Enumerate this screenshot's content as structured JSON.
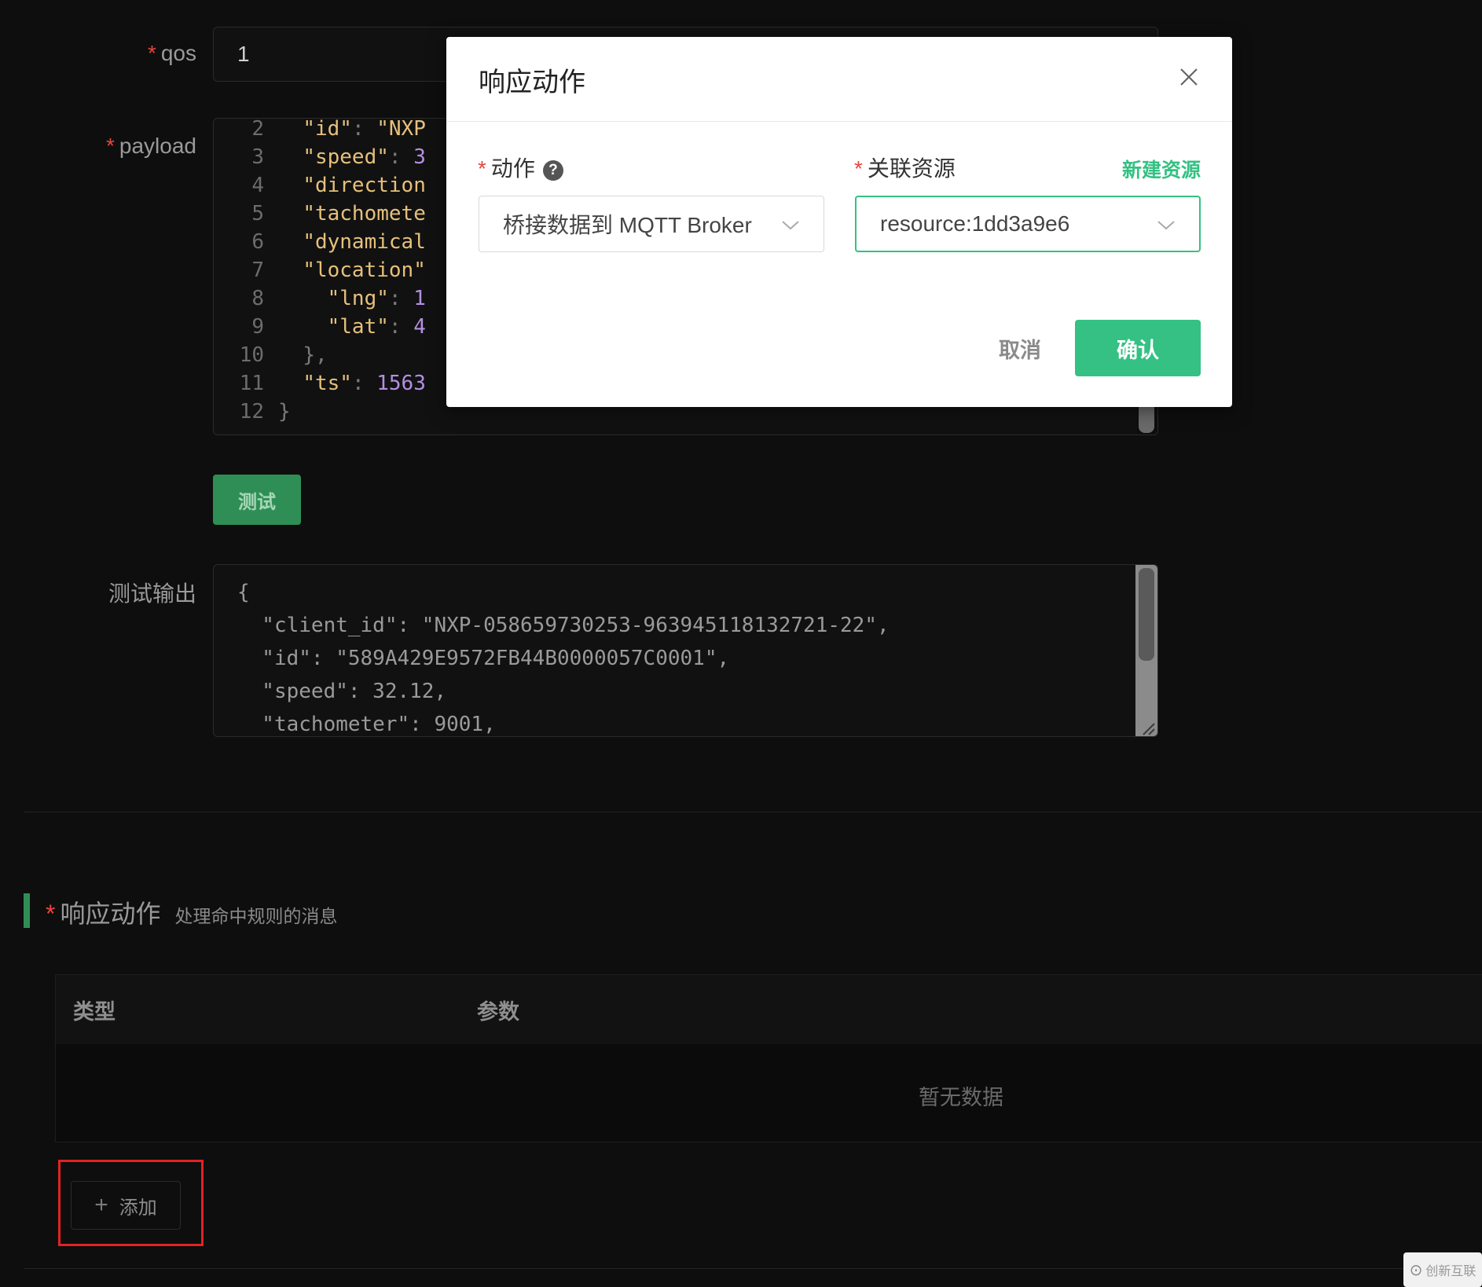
{
  "form": {
    "qos_label": "qos",
    "qos_value": "1",
    "payload_label": "payload",
    "test_button": "测试",
    "test_output_label": "测试输出"
  },
  "payload_editor": {
    "lines": [
      {
        "no": "2",
        "indent": "  ",
        "key": "\"id\"",
        "sep": ": ",
        "value": "\"NXP"
      },
      {
        "no": "3",
        "indent": "  ",
        "key": "\"speed\"",
        "sep": ": ",
        "value": "3"
      },
      {
        "no": "4",
        "indent": "  ",
        "key": "\"direction",
        "sep": "",
        "value": ""
      },
      {
        "no": "5",
        "indent": "  ",
        "key": "\"tachomete",
        "sep": "",
        "value": ""
      },
      {
        "no": "6",
        "indent": "  ",
        "key": "\"dynamical",
        "sep": "",
        "value": ""
      },
      {
        "no": "7",
        "indent": "  ",
        "key": "\"location\"",
        "sep": "",
        "value": ""
      },
      {
        "no": "8",
        "indent": "    ",
        "key": "\"lng\"",
        "sep": ": ",
        "value": "1"
      },
      {
        "no": "9",
        "indent": "    ",
        "key": "\"lat\"",
        "sep": ": ",
        "value": "4"
      },
      {
        "no": "10",
        "indent": "  ",
        "key": "",
        "sep": "},",
        "value": ""
      },
      {
        "no": "11",
        "indent": "  ",
        "key": "\"ts\"",
        "sep": ": ",
        "value": "1563"
      },
      {
        "no": "12",
        "indent": "",
        "key": "",
        "sep": "}",
        "value": ""
      }
    ]
  },
  "test_output": {
    "lines": [
      "{",
      "  \"client_id\": \"NXP-058659730253-963945118132721-22\",",
      "  \"id\": \"589A429E9572FB44B0000057C0001\",",
      "  \"speed\": 32.12,",
      "  \"tachometer\": 9001,"
    ]
  },
  "actions_section": {
    "title": "响应动作",
    "subtitle": "处理命中规则的消息",
    "table_headers": [
      "类型",
      "参数"
    ],
    "empty_text": "暂无数据",
    "add_button": "添加"
  },
  "modal": {
    "title": "响应动作",
    "action_label": "动作",
    "action_value": "桥接数据到 MQTT Broker",
    "resource_label": "关联资源",
    "new_resource_link": "新建资源",
    "resource_value": "resource:1dd3a9e6",
    "cancel_button": "取消",
    "confirm_button": "确认"
  },
  "watermark": "创新互联",
  "colors": {
    "accent": "#34c183",
    "required": "#e8453c",
    "highlight": "#e32222"
  }
}
